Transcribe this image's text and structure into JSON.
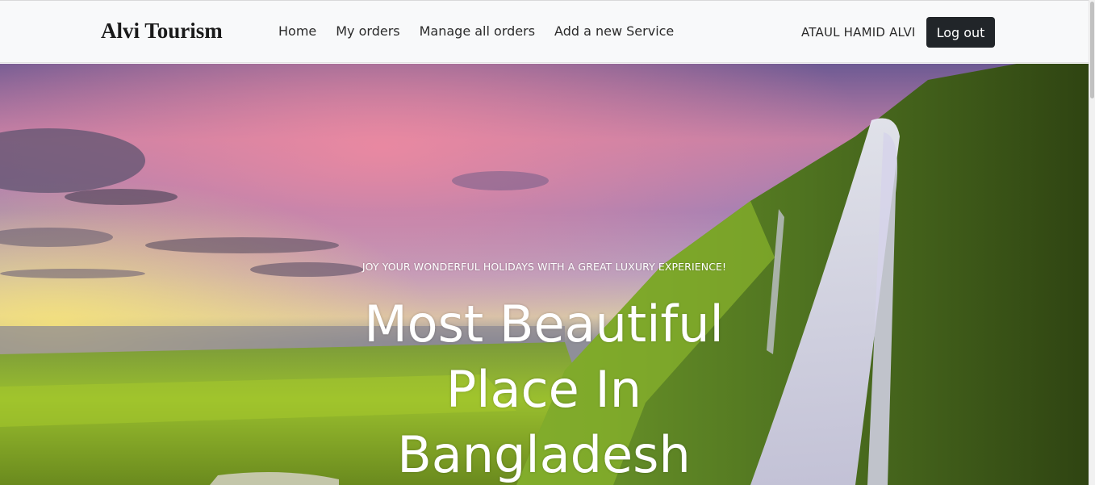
{
  "navbar": {
    "brand": "Alvi Tourism",
    "links": [
      {
        "label": "Home"
      },
      {
        "label": "My orders"
      },
      {
        "label": "Manage all orders"
      },
      {
        "label": "Add a new Service"
      }
    ],
    "user_name": "ATAUL HAMID ALVI",
    "logout_label": "Log out"
  },
  "hero": {
    "subtitle": "JOY YOUR WONDERFUL HOLIDAYS WITH A GREAT LUXURY EXPERIENCE!",
    "title": "Most Beautiful Place In Bangladesh",
    "image": "waterfall-landscape"
  },
  "colors": {
    "navbar_bg": "#f8f9fa",
    "button_bg": "#212529",
    "button_text": "#ffffff",
    "hero_text": "#ffffff"
  }
}
